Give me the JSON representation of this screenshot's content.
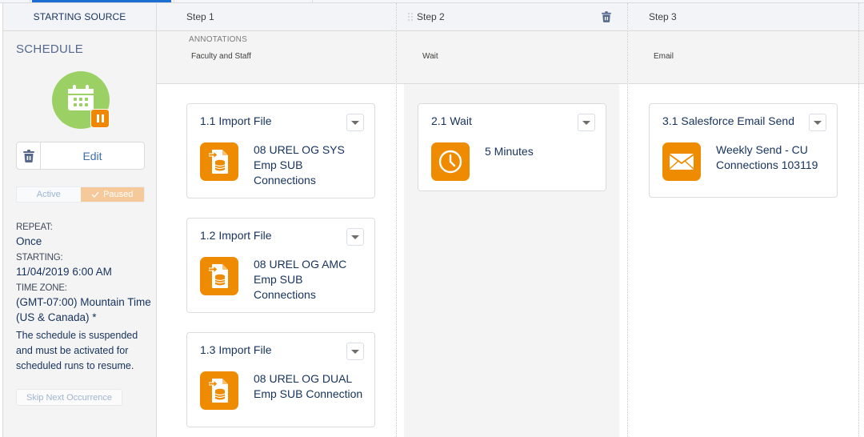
{
  "topbar": {
    "active_tab_indicator": true
  },
  "sidebar": {
    "header": "STARTING SOURCE",
    "title": "SCHEDULE",
    "icon": "calendar-icon",
    "status_badge_icon": "pause-icon",
    "delete_icon": "trash-icon",
    "edit_label": "Edit",
    "toggle": {
      "active_label": "Active",
      "paused_label": "Paused",
      "selected": "Paused"
    },
    "repeat_label": "REPEAT:",
    "repeat_value": "Once",
    "starting_label": "STARTING:",
    "starting_value": "11/04/2019 6:00 AM",
    "timezone_label": "TIME ZONE:",
    "timezone_value": "(GMT-07:00) Mountain Time (US & Canada) *",
    "note": "The schedule is suspended and must be activated for scheduled runs to resume.",
    "skip_label": "Skip Next Occurrence"
  },
  "colors": {
    "accent_orange": "#ef8b00",
    "schedule_green": "#9bd164",
    "text_navy": "#16325c",
    "tab_blue": "#1b6fd1"
  },
  "steps": [
    {
      "header": "Step 1",
      "annotations_label": "ANNOTATIONS",
      "annotation": "Faculty and Staff",
      "cards": [
        {
          "title": "1.1 Import File",
          "icon": "import-file-icon",
          "desc": "08 UREL OG SYS Emp SUB Connections"
        },
        {
          "title": "1.2 Import File",
          "icon": "import-file-icon",
          "desc": "08 UREL OG AMC Emp SUB Connections"
        },
        {
          "title": "1.3 Import File",
          "icon": "import-file-icon",
          "desc": "08 UREL OG DUAL Emp SUB Connection"
        }
      ]
    },
    {
      "header": "Step 2",
      "annotation": "Wait",
      "delete_icon": "trash-icon",
      "cards": [
        {
          "title": "2.1 Wait",
          "icon": "clock-icon",
          "desc": "5 Minutes"
        }
      ]
    },
    {
      "header": "Step 3",
      "annotation": "Email",
      "cards": [
        {
          "title": "3.1 Salesforce Email Send",
          "icon": "email-icon",
          "desc": "Weekly Send - CU Connections 103119"
        }
      ]
    }
  ]
}
